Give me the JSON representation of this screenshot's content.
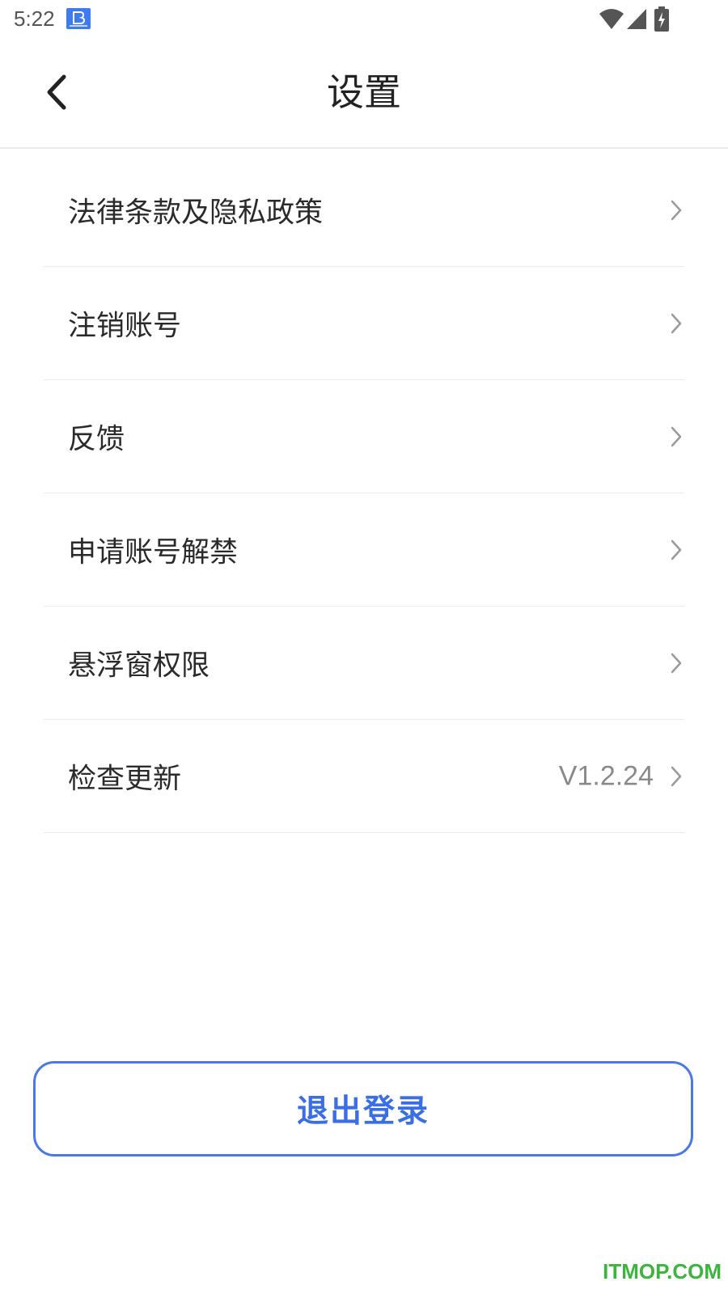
{
  "status_bar": {
    "time": "5:22",
    "app_icon": "notification-app-icon",
    "icons": [
      "wifi-icon",
      "cell-signal-icon",
      "battery-charging-icon"
    ]
  },
  "header": {
    "back_icon": "chevron-left-icon",
    "title": "设置"
  },
  "menu": {
    "items": [
      {
        "label": "法律条款及隐私政策",
        "value": ""
      },
      {
        "label": "注销账号",
        "value": ""
      },
      {
        "label": "反馈",
        "value": ""
      },
      {
        "label": "申请账号解禁",
        "value": ""
      },
      {
        "label": "悬浮窗权限",
        "value": ""
      },
      {
        "label": "检查更新",
        "value": "V1.2.24"
      }
    ],
    "chevron_icon": "chevron-right-icon"
  },
  "logout": {
    "label": "退出登录"
  },
  "colors": {
    "accent": "#4a78e8",
    "divider": "#ececec",
    "watermark": "#3bb53b"
  },
  "watermark": {
    "text": "ITMOP.COM"
  }
}
